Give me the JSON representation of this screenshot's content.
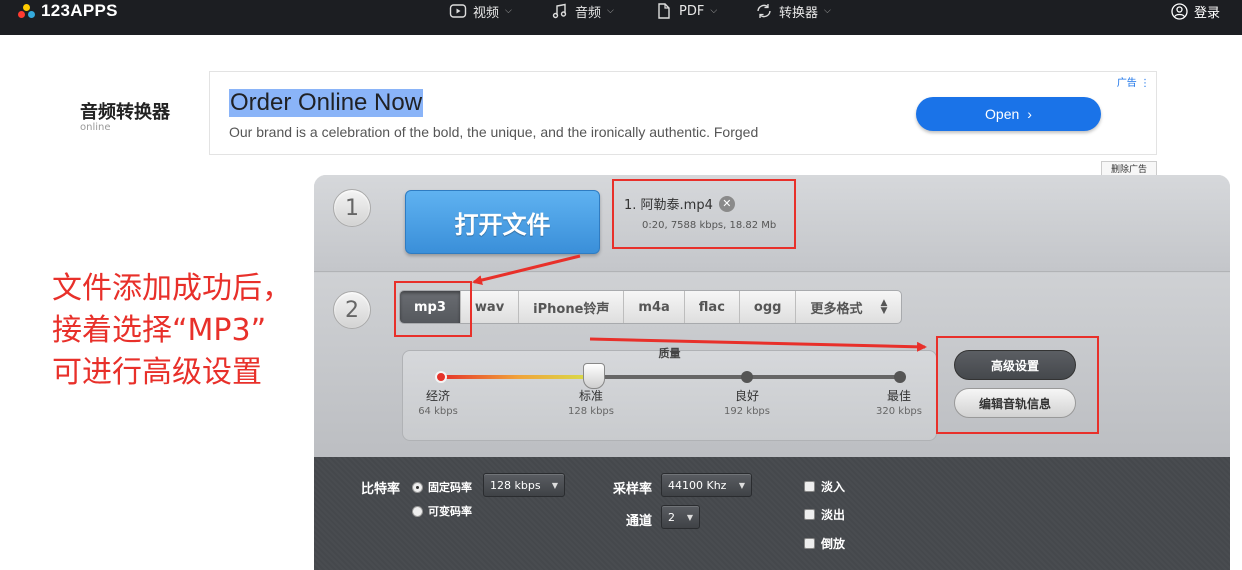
{
  "topbar": {
    "brand": "123APPS",
    "nav": [
      {
        "label": "视频",
        "icon": "video-icon"
      },
      {
        "label": "音频",
        "icon": "music-note-icon"
      },
      {
        "label": "PDF",
        "icon": "document-icon"
      },
      {
        "label": "转换器",
        "icon": "convert-icon"
      }
    ],
    "login_label": "登录"
  },
  "page": {
    "title": "音频转换器",
    "subtitle": "online"
  },
  "ad": {
    "tag": "广告",
    "title": "Order Online Now",
    "description": "Our brand is a celebration of the bold, the unique, and the ironically authentic. Forged",
    "cta": "Open",
    "remove_label": "删除广告"
  },
  "converter": {
    "step1": {
      "number": "1",
      "open_button": "打开文件",
      "file": {
        "name": "1. 阿勒泰.mp4",
        "meta": "0:20, 7588 kbps, 18.82 Mb"
      }
    },
    "step2": {
      "number": "2",
      "formats": [
        "mp3",
        "wav",
        "iPhone铃声",
        "m4a",
        "flac",
        "ogg",
        "更多格式"
      ],
      "selected_format": "mp3",
      "quality": {
        "label": "质量",
        "selected_index": 1,
        "level_fraction": 0.333,
        "levels": [
          {
            "name": "经济",
            "bitrate": "64 kbps"
          },
          {
            "name": "标准",
            "bitrate": "128 kbps"
          },
          {
            "name": "良好",
            "bitrate": "192 kbps"
          },
          {
            "name": "最佳",
            "bitrate": "320 kbps"
          }
        ]
      },
      "advanced_button": "高级设置",
      "edit_tags_button": "编辑音轨信息"
    },
    "advanced": {
      "bitrate_label": "比特率",
      "constant_label": "固定码率",
      "variable_label": "可变码率",
      "bitrate_value": "128 kbps",
      "samplerate_label": "采样率",
      "samplerate_value": "44100 Khz",
      "channels_label": "通道",
      "channels_value": "2",
      "fade_in": "淡入",
      "fade_out": "淡出",
      "reverse": "倒放"
    }
  },
  "annotation": {
    "lines": [
      "文件添加成功后，",
      "接着选择“MP3”",
      "可进行高级设置"
    ]
  },
  "colors": {
    "annotation_red": "#e8302a",
    "primary_blue": "#3a8fd9",
    "ad_blue": "#1a73e8",
    "topbar": "#1c1e22"
  }
}
